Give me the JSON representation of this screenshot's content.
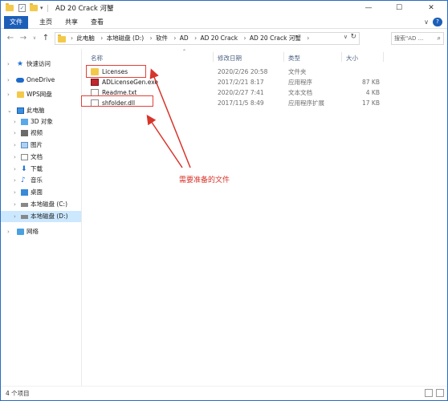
{
  "window": {
    "title": "AD 20 Crack 河蟹",
    "minimize_label": "—",
    "maximize_label": "☐",
    "close_label": "✕",
    "ribbon_expand_label": "∨",
    "help_label": "?"
  },
  "ribbon": {
    "tabs": [
      "文件",
      "主页",
      "共享",
      "查看"
    ]
  },
  "address": {
    "back": "←",
    "forward": "→",
    "recent": "∨",
    "up": "↑",
    "crumbs": [
      "此电脑",
      "本地磁盘 (D:)",
      "软件",
      "AD",
      "AD 20 Crack",
      "AD 20 Crack 河蟹"
    ],
    "separator": "›",
    "dropdown": "∨",
    "refresh": "↻"
  },
  "search": {
    "placeholder": "搜索\"AD ...",
    "icon": "search-icon"
  },
  "sidebar": {
    "items": [
      {
        "label": "快速访问",
        "icon": "star-icon"
      },
      {
        "label": "OneDrive",
        "icon": "cloud-icon"
      },
      {
        "label": "WPS网盘",
        "icon": "wps-icon"
      },
      {
        "label": "此电脑",
        "icon": "computer-icon"
      },
      {
        "label": "3D 对象",
        "icon": "cube-icon"
      },
      {
        "label": "视频",
        "icon": "video-icon"
      },
      {
        "label": "图片",
        "icon": "picture-icon"
      },
      {
        "label": "文档",
        "icon": "document-icon"
      },
      {
        "label": "下载",
        "icon": "download-icon"
      },
      {
        "label": "音乐",
        "icon": "music-icon"
      },
      {
        "label": "桌面",
        "icon": "desktop-icon"
      },
      {
        "label": "本地磁盘 (C:)",
        "icon": "drive-icon"
      },
      {
        "label": "本地磁盘 (D:)",
        "icon": "drive-icon"
      },
      {
        "label": "网络",
        "icon": "network-icon"
      }
    ]
  },
  "columns": {
    "name": "名称",
    "date": "修改日期",
    "type": "类型",
    "size": "大小"
  },
  "files": [
    {
      "name": "Licenses",
      "date": "2020/2/26 20:58",
      "type": "文件夹",
      "size": ""
    },
    {
      "name": "ADLicenseGen.exe",
      "date": "2017/2/21 8:17",
      "type": "应用程序",
      "size": "87 KB"
    },
    {
      "name": "Readme.txt",
      "date": "2020/2/27 7:41",
      "type": "文本文档",
      "size": "4 KB"
    },
    {
      "name": "shfolder.dll",
      "date": "2017/11/5 8:49",
      "type": "应用程序扩展",
      "size": "17 KB"
    }
  ],
  "annotation": {
    "text": "需要准备的文件",
    "color": "#d8342b"
  },
  "status": {
    "count": "4 个项目"
  },
  "colors": {
    "accent": "#1c5fb8",
    "selected": "#cce8ff",
    "annotation": "#e0413a"
  }
}
